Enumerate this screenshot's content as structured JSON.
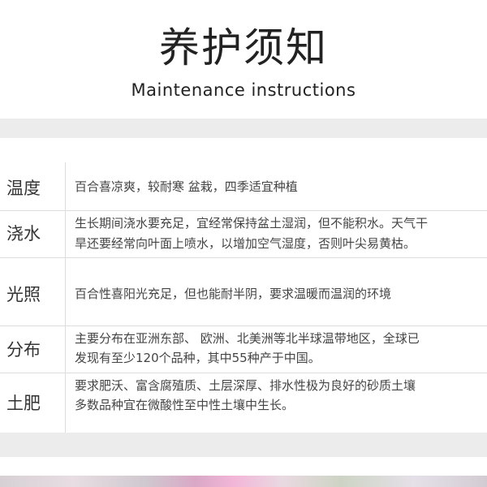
{
  "header": {
    "title": "养护须知",
    "subtitle": "Maintenance instructions"
  },
  "rows": [
    {
      "label": "温度",
      "lines": [
        "百合喜凉爽，较耐寒 盆栽，四季适宜种植"
      ]
    },
    {
      "label": "浇水",
      "lines": [
        "生长期间浇水要充足，宜经常保持盆土湿润，但不能积水。天气干",
        "旱还要经常向叶面上喷水，以增加空气湿度，否则叶尖易黄枯。"
      ]
    },
    {
      "label": "光照",
      "lines": [
        "百合性喜阳光充足，但也能耐半阴，要求温暖而温润的环境"
      ]
    },
    {
      "label": "分布",
      "lines": [
        "主要分布在亚洲东部、 欧洲、北美洲等北半球温带地区，全球已",
        "发现有至少120个品种，其中55种产于中国。"
      ]
    },
    {
      "label": "土肥",
      "lines": [
        "要求肥沃、富含腐殖质、土层深厚、排水性极为良好的砂质土壤",
        "多数品种宜在微酸性至中性土壤中生长。"
      ]
    }
  ]
}
